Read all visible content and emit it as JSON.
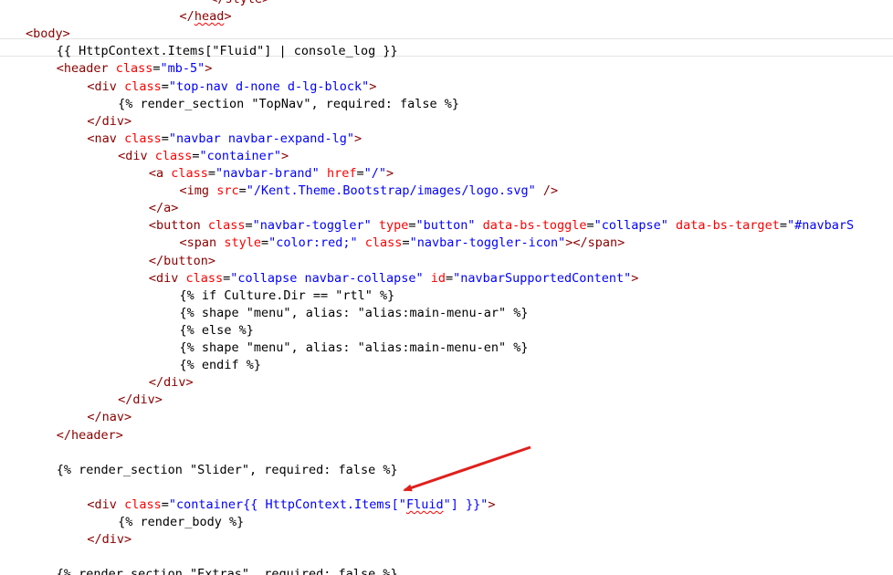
{
  "code_lines": [
    {
      "indent": 0,
      "tokens": [
        {
          "t": "tag",
          "v": "</style>"
        }
      ]
    },
    {
      "indent": 0,
      "tokens": [
        {
          "t": "tag",
          "v": "</"
        },
        {
          "t": "tag",
          "v": "head",
          "squig": true
        },
        {
          "t": "tag",
          "v": ">"
        }
      ]
    },
    {
      "indent": 0,
      "tokens": [
        {
          "t": "tag",
          "v": "<body>"
        }
      ]
    },
    {
      "indent": 0,
      "tokens": [
        {
          "t": "txt",
          "v": "{{ HttpContext.Items[\"Fluid\"] | console_log }}"
        }
      ]
    },
    {
      "indent": 0,
      "tokens": [
        {
          "t": "tag",
          "v": "<header "
        },
        {
          "t": "attr",
          "v": "class"
        },
        {
          "t": "txt",
          "v": "="
        },
        {
          "t": "val",
          "v": "\"mb-5\""
        },
        {
          "t": "tag",
          "v": ">"
        }
      ]
    },
    {
      "indent": 0,
      "tokens": [
        {
          "t": "tag",
          "v": "<div "
        },
        {
          "t": "attr",
          "v": "class"
        },
        {
          "t": "txt",
          "v": "="
        },
        {
          "t": "val",
          "v": "\"top-nav d-none d-lg-block\""
        },
        {
          "t": "tag",
          "v": ">"
        }
      ]
    },
    {
      "indent": 0,
      "tokens": [
        {
          "t": "txt",
          "v": "{% render_section \"TopNav\", required: false %}"
        }
      ]
    },
    {
      "indent": 0,
      "tokens": [
        {
          "t": "tag",
          "v": "</div>"
        }
      ]
    },
    {
      "indent": 0,
      "tokens": [
        {
          "t": "tag",
          "v": "<nav "
        },
        {
          "t": "attr",
          "v": "class"
        },
        {
          "t": "txt",
          "v": "="
        },
        {
          "t": "val",
          "v": "\"navbar navbar-expand-lg\""
        },
        {
          "t": "tag",
          "v": ">"
        }
      ]
    },
    {
      "indent": 0,
      "tokens": [
        {
          "t": "tag",
          "v": "<div "
        },
        {
          "t": "attr",
          "v": "class"
        },
        {
          "t": "txt",
          "v": "="
        },
        {
          "t": "val",
          "v": "\"container\""
        },
        {
          "t": "tag",
          "v": ">"
        }
      ]
    },
    {
      "indent": 0,
      "tokens": [
        {
          "t": "tag",
          "v": "<a "
        },
        {
          "t": "attr",
          "v": "class"
        },
        {
          "t": "txt",
          "v": "="
        },
        {
          "t": "val",
          "v": "\"navbar-brand\""
        },
        {
          "t": "txt",
          "v": " "
        },
        {
          "t": "attr",
          "v": "href"
        },
        {
          "t": "txt",
          "v": "="
        },
        {
          "t": "val",
          "v": "\"/\""
        },
        {
          "t": "tag",
          "v": ">"
        }
      ]
    },
    {
      "indent": 0,
      "tokens": [
        {
          "t": "tag",
          "v": "<img "
        },
        {
          "t": "attr",
          "v": "src"
        },
        {
          "t": "txt",
          "v": "="
        },
        {
          "t": "val",
          "v": "\"/Kent.Theme.Bootstrap/images/logo.svg\""
        },
        {
          "t": "tag",
          "v": " />"
        }
      ]
    },
    {
      "indent": 0,
      "tokens": [
        {
          "t": "tag",
          "v": "</a>"
        }
      ]
    },
    {
      "indent": 0,
      "tokens": [
        {
          "t": "tag",
          "v": "<button "
        },
        {
          "t": "attr",
          "v": "class"
        },
        {
          "t": "txt",
          "v": "="
        },
        {
          "t": "val",
          "v": "\"navbar-toggler\""
        },
        {
          "t": "txt",
          "v": " "
        },
        {
          "t": "attr",
          "v": "type"
        },
        {
          "t": "txt",
          "v": "="
        },
        {
          "t": "val",
          "v": "\"button\""
        },
        {
          "t": "txt",
          "v": " "
        },
        {
          "t": "attr",
          "v": "data-bs-toggle"
        },
        {
          "t": "txt",
          "v": "="
        },
        {
          "t": "val",
          "v": "\"collapse\""
        },
        {
          "t": "txt",
          "v": " "
        },
        {
          "t": "attr",
          "v": "data-bs-target"
        },
        {
          "t": "txt",
          "v": "="
        },
        {
          "t": "val",
          "v": "\"#navbarS"
        }
      ]
    },
    {
      "indent": 0,
      "tokens": [
        {
          "t": "tag",
          "v": "<span "
        },
        {
          "t": "attr",
          "v": "style"
        },
        {
          "t": "txt",
          "v": "="
        },
        {
          "t": "val",
          "v": "\"color:red;\""
        },
        {
          "t": "txt",
          "v": " "
        },
        {
          "t": "attr",
          "v": "class"
        },
        {
          "t": "txt",
          "v": "="
        },
        {
          "t": "val",
          "v": "\"navbar-toggler-icon\""
        },
        {
          "t": "tag",
          "v": "></span>"
        }
      ]
    },
    {
      "indent": 0,
      "tokens": [
        {
          "t": "tag",
          "v": "</button>"
        }
      ]
    },
    {
      "indent": 0,
      "tokens": [
        {
          "t": "tag",
          "v": "<div "
        },
        {
          "t": "attr",
          "v": "class"
        },
        {
          "t": "txt",
          "v": "="
        },
        {
          "t": "val",
          "v": "\"collapse navbar-collapse\""
        },
        {
          "t": "txt",
          "v": " "
        },
        {
          "t": "attr",
          "v": "id"
        },
        {
          "t": "txt",
          "v": "="
        },
        {
          "t": "val",
          "v": "\"navbarSupportedContent\""
        },
        {
          "t": "tag",
          "v": ">"
        }
      ]
    },
    {
      "indent": 0,
      "tokens": [
        {
          "t": "txt",
          "v": "{% if Culture.Dir == \"rtl\" %}"
        }
      ]
    },
    {
      "indent": 0,
      "tokens": [
        {
          "t": "txt",
          "v": "{% shape \"menu\", alias: \"alias:main-menu-ar\" %}"
        }
      ]
    },
    {
      "indent": 0,
      "tokens": [
        {
          "t": "txt",
          "v": "{% else %}"
        }
      ]
    },
    {
      "indent": 0,
      "tokens": [
        {
          "t": "txt",
          "v": "{% shape \"menu\", alias: \"alias:main-menu-en\" %}"
        }
      ]
    },
    {
      "indent": 0,
      "tokens": [
        {
          "t": "txt",
          "v": "{% endif %}"
        }
      ]
    },
    {
      "indent": 0,
      "tokens": [
        {
          "t": "tag",
          "v": "</div>"
        }
      ]
    },
    {
      "indent": 0,
      "tokens": [
        {
          "t": "tag",
          "v": "</div>"
        }
      ]
    },
    {
      "indent": 0,
      "tokens": [
        {
          "t": "tag",
          "v": "</nav>"
        }
      ]
    },
    {
      "indent": 0,
      "tokens": [
        {
          "t": "tag",
          "v": "</header>"
        }
      ]
    },
    {
      "indent": 0,
      "tokens": []
    },
    {
      "indent": 0,
      "tokens": [
        {
          "t": "txt",
          "v": "{% render_section \"Slider\", required: false %}"
        }
      ]
    },
    {
      "indent": 0,
      "tokens": []
    },
    {
      "indent": 0,
      "tokens": [
        {
          "t": "tag",
          "v": "<div "
        },
        {
          "t": "attr",
          "v": "class"
        },
        {
          "t": "txt",
          "v": "="
        },
        {
          "t": "val",
          "v": "\"container{{ HttpContext.Items[\""
        },
        {
          "t": "val",
          "v": "Fluid",
          "squig": true
        },
        {
          "t": "val",
          "v": "\"] }}\""
        },
        {
          "t": "tag",
          "v": ">"
        }
      ]
    },
    {
      "indent": 0,
      "tokens": [
        {
          "t": "txt",
          "v": "{% render_body %}"
        }
      ]
    },
    {
      "indent": 0,
      "tokens": [
        {
          "t": "tag",
          "v": "</div>"
        }
      ]
    },
    {
      "indent": 0,
      "tokens": []
    },
    {
      "indent": 0,
      "tokens": [
        {
          "t": "txt",
          "v": "{% render_section \"Extras\", required: false %}"
        }
      ]
    }
  ],
  "colors": {
    "tag": "#8b0000",
    "attribute": "#ff0000",
    "value": "#0000ff",
    "text": "#000000",
    "annotation_arrow": "#e0201c"
  },
  "annotation": {
    "type": "arrow",
    "points_to": "Fluid"
  }
}
